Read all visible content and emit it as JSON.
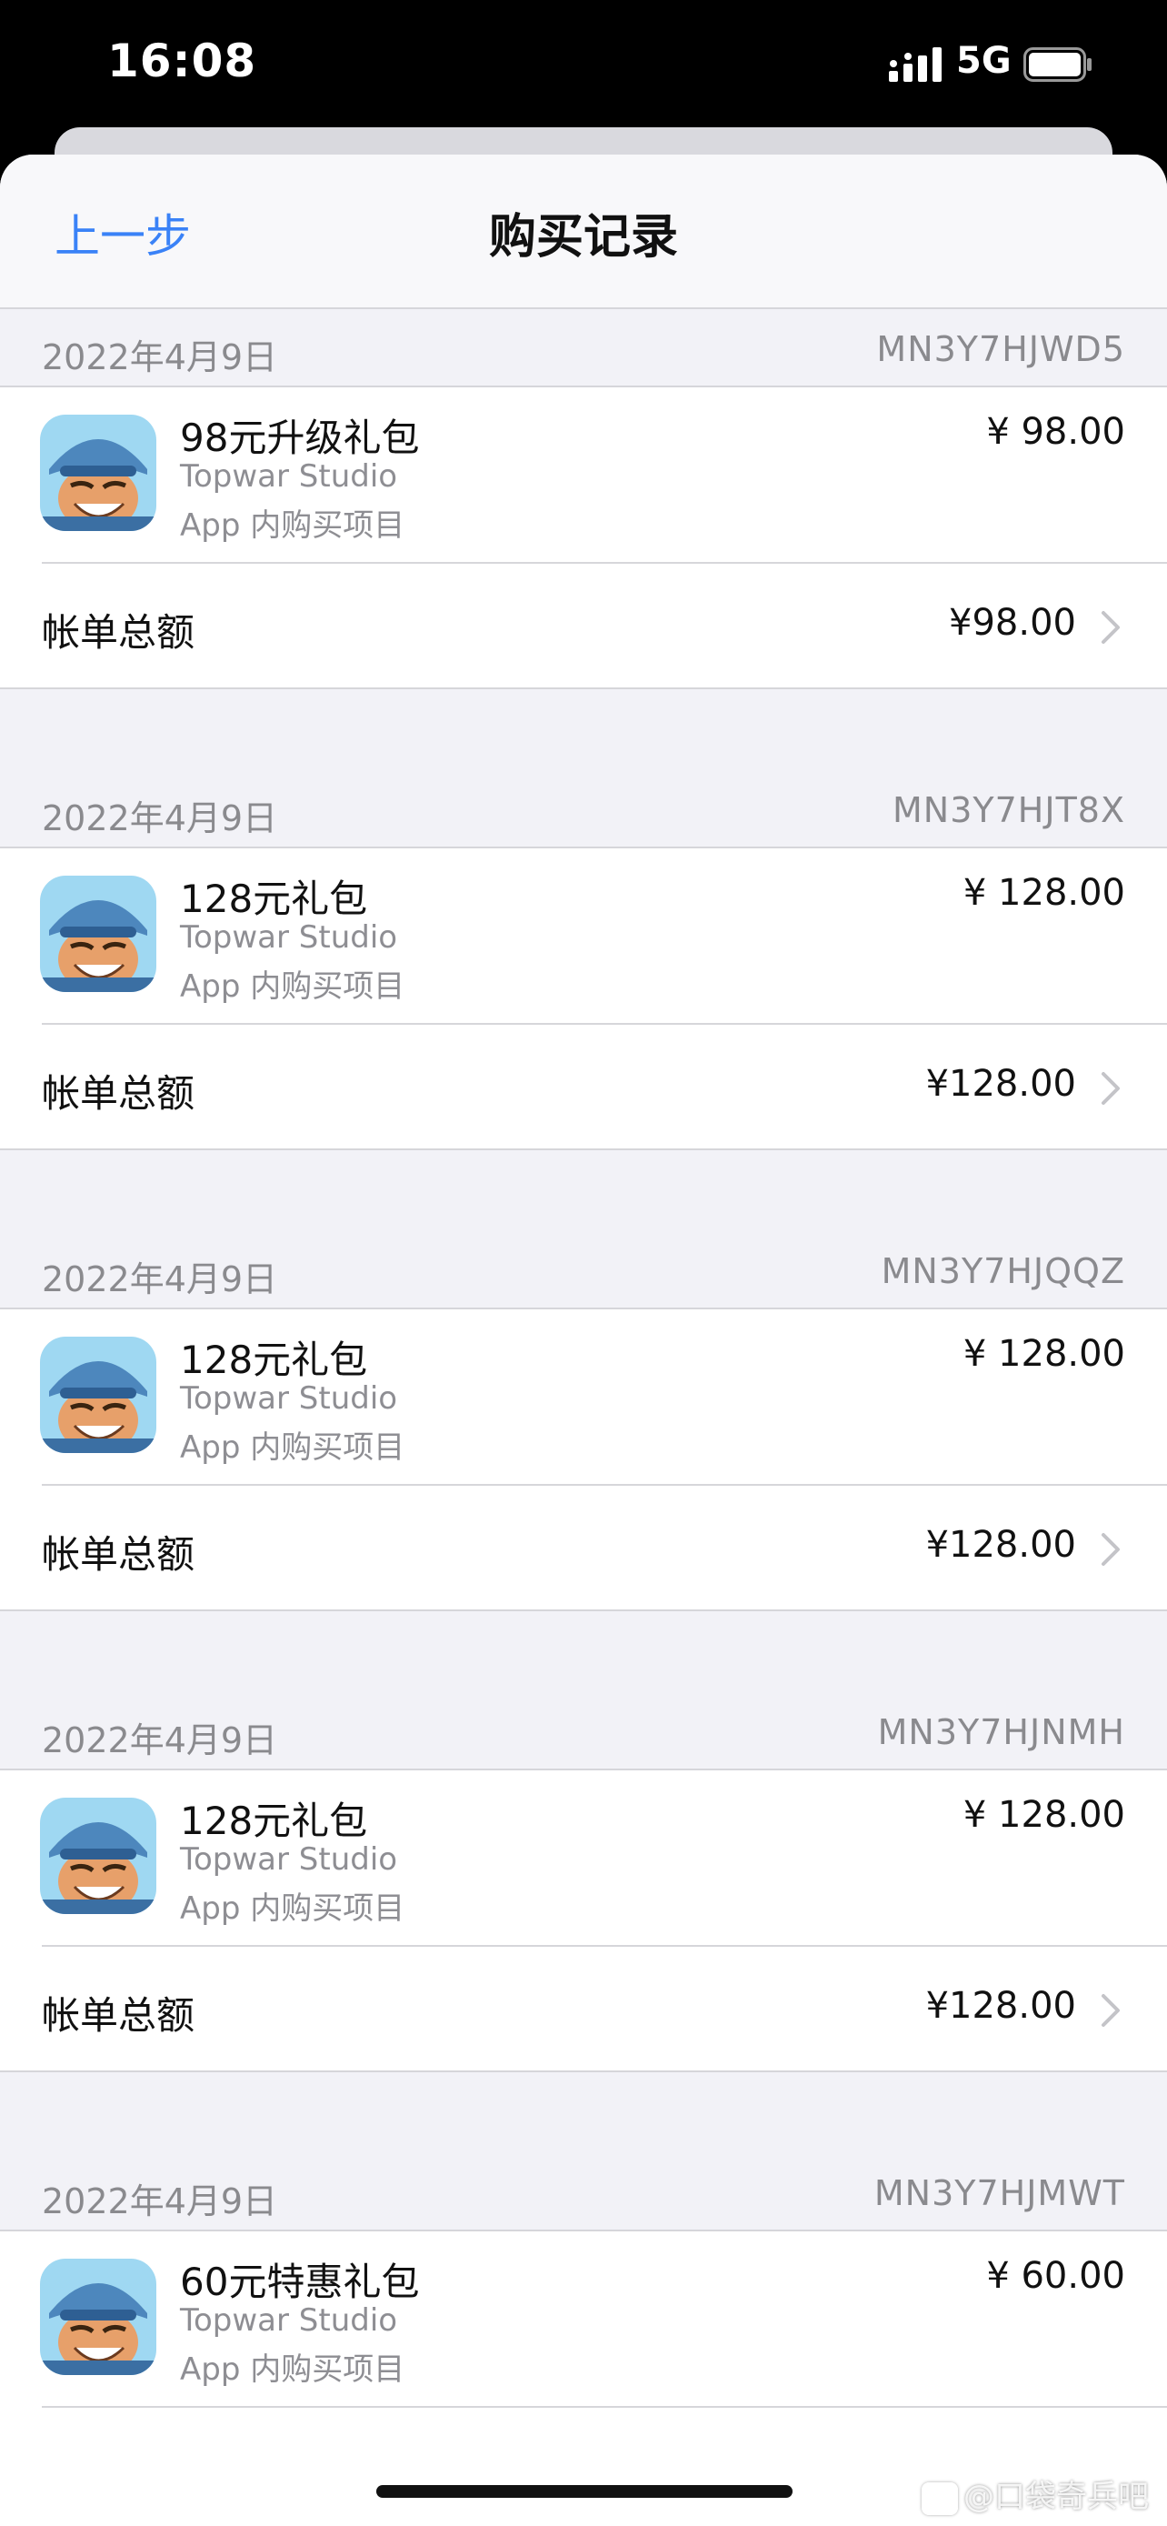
{
  "status_bar": {
    "time": "16:08",
    "network": "5G",
    "signal_icon": "signal-bars-icon",
    "battery_icon": "battery-icon"
  },
  "nav": {
    "back_label": "上一步",
    "title": "购买记录"
  },
  "colors": {
    "accent": "#3a82f7",
    "background": "#f2f2f7",
    "secondary_text": "#8e8e93"
  },
  "purchases": [
    {
      "date": "2022年4月9日",
      "order_id": "MN3Y7HJWD5",
      "item_name": "98元升级礼包",
      "developer": "Topwar Studio",
      "type": "App 内购买项目",
      "price": "¥ 98.00",
      "total_label": "帐单总额",
      "total": "¥98.00"
    },
    {
      "date": "2022年4月9日",
      "order_id": "MN3Y7HJT8X",
      "item_name": "128元礼包",
      "developer": "Topwar Studio",
      "type": "App 内购买项目",
      "price": "¥ 128.00",
      "total_label": "帐单总额",
      "total": "¥128.00"
    },
    {
      "date": "2022年4月9日",
      "order_id": "MN3Y7HJQQZ",
      "item_name": "128元礼包",
      "developer": "Topwar Studio",
      "type": "App 内购买项目",
      "price": "¥ 128.00",
      "total_label": "帐单总额",
      "total": "¥128.00"
    },
    {
      "date": "2022年4月9日",
      "order_id": "MN3Y7HJNMH",
      "item_name": "128元礼包",
      "developer": "Topwar Studio",
      "type": "App 内购买项目",
      "price": "¥ 128.00",
      "total_label": "帐单总额",
      "total": "¥128.00"
    },
    {
      "date": "2022年4月9日",
      "order_id": "MN3Y7HJMWT",
      "item_name": "60元特惠礼包",
      "developer": "Topwar Studio",
      "type": "App 内购买项目",
      "price": "¥ 60.00"
    }
  ],
  "watermark": "@口袋奇兵吧"
}
